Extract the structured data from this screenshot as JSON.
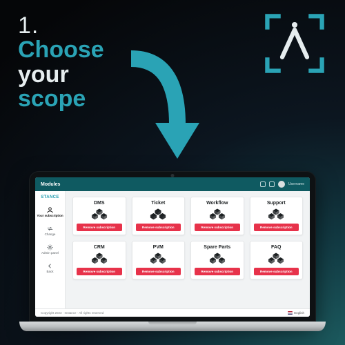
{
  "headline": {
    "number": "1.",
    "line1": "Choose",
    "line2": "your",
    "line3": "scope"
  },
  "colors": {
    "accent": "#2aa3b5",
    "buttonRed": "#e7324a",
    "topbar": "#0f5a61"
  },
  "app": {
    "brand": "STANCE",
    "topbar": {
      "title": "Modules",
      "user": "Username"
    },
    "sidebar": {
      "items": [
        {
          "label": "Your subscription",
          "icon": "user"
        },
        {
          "label": "Change",
          "icon": "change"
        },
        {
          "label": "Admin panel",
          "icon": "admin"
        },
        {
          "label": "Back",
          "icon": "back"
        }
      ],
      "selected": 0
    },
    "modules": [
      {
        "title": "DMS"
      },
      {
        "title": "Ticket"
      },
      {
        "title": "Workflow"
      },
      {
        "title": "Support"
      },
      {
        "title": "CRM"
      },
      {
        "title": "PVM"
      },
      {
        "title": "Spare Parts"
      },
      {
        "title": "FAQ"
      }
    ],
    "buttonLabel": "Remove subscription",
    "footer": {
      "copyright": "Copyright 2023 · Instance · All rights reserved",
      "lang": "English"
    }
  }
}
